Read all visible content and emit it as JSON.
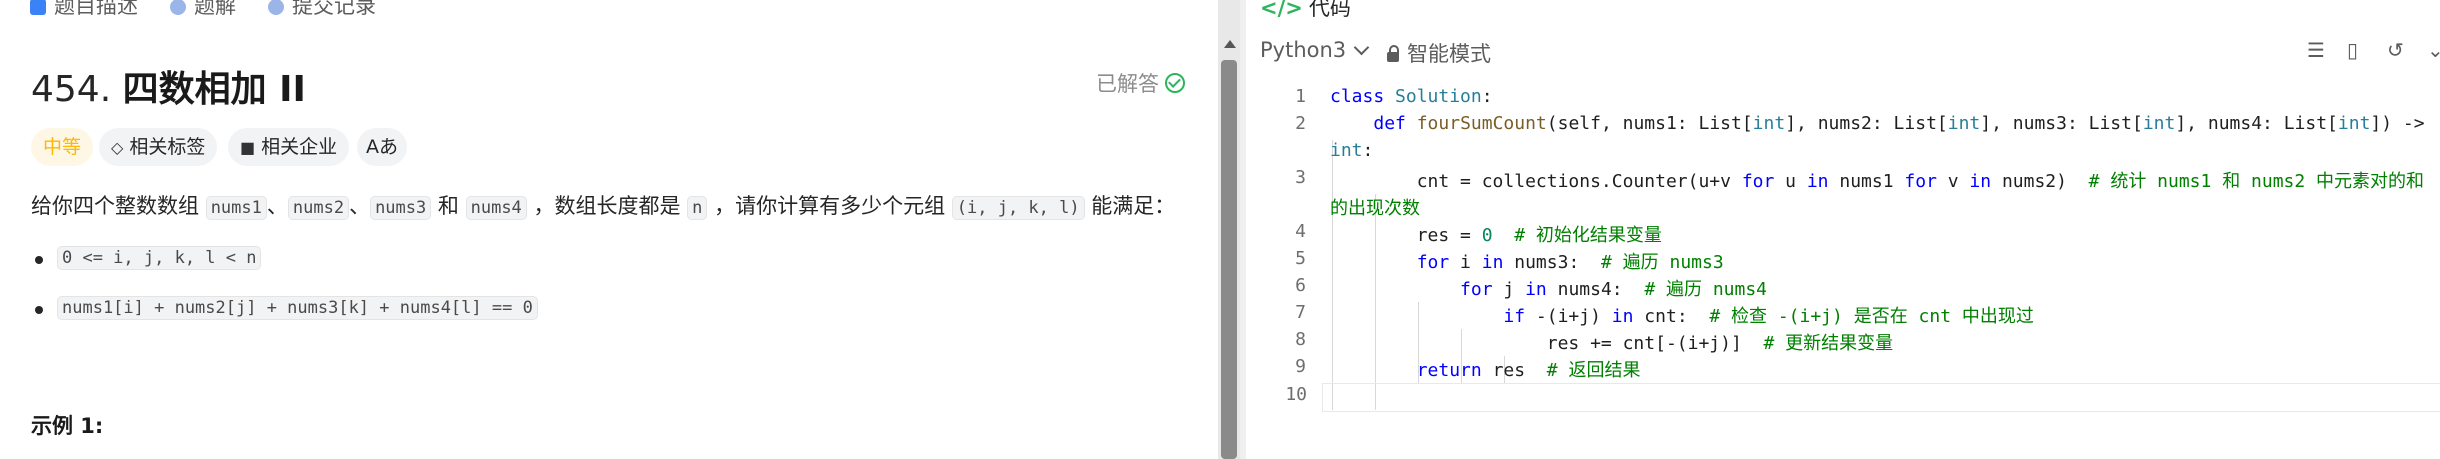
{
  "left": {
    "tabs": [
      "题目描述",
      "题解",
      "提交记录"
    ],
    "problem_number": "454.",
    "problem_name": "四数相加 II",
    "solved_label": "已解答",
    "tags": {
      "difficulty": "中等",
      "related_tags": "相关标签",
      "related_companies": "相关企业",
      "translate": "Aあ"
    },
    "desc": {
      "p1": "给你四个整数数组 ",
      "c1": "nums1",
      "sep1": "、",
      "c2": "nums2",
      "sep2": "、",
      "c3": "nums3",
      "p2": " 和 ",
      "c4": "nums4",
      "p3": " ，数组长度都是 ",
      "c5": "n",
      "p4": " ，请你计算有多少个元组 ",
      "c6": "(i, j, k, l)",
      "p5": " 能满足："
    },
    "bullets": [
      "0 <= i, j, k, l < n",
      "nums1[i] + nums2[j] + nums3[k] + nums4[l] == 0"
    ],
    "example_heading": "示例 1:"
  },
  "right": {
    "header_icon": "</>",
    "header_label": "代码",
    "language": "Python3",
    "mode": "智能模式",
    "line_numbers": [
      "1",
      "2",
      "",
      "3",
      "",
      "4",
      "5",
      "6",
      "7",
      "8",
      "9",
      "10"
    ]
  },
  "colors": {
    "keyword": "#0000ff",
    "function": "#795e26",
    "class": "#267f99",
    "comment": "#008000",
    "number": "#098658",
    "difficulty_medium": "#ffb800",
    "solved_green": "#2db55d"
  }
}
